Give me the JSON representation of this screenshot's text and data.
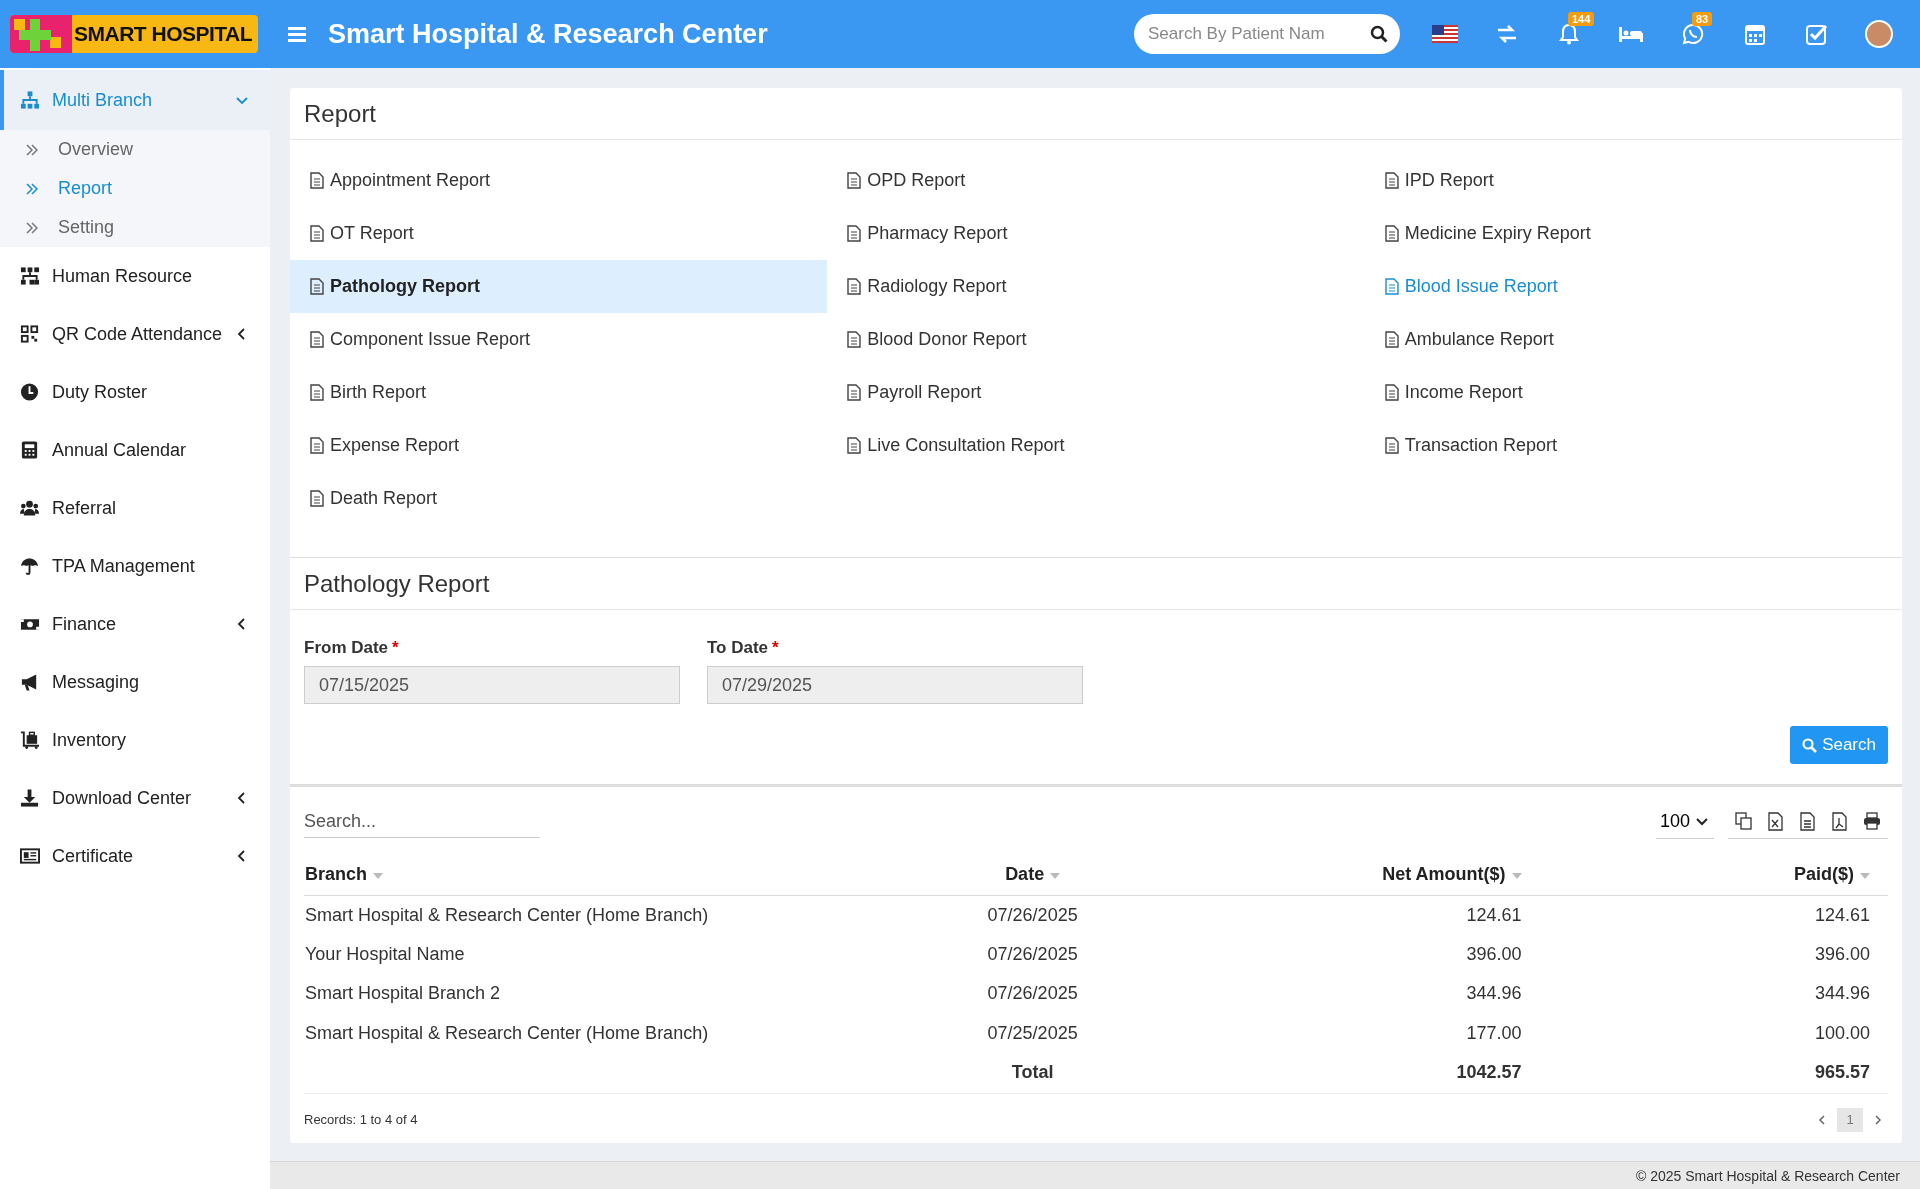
{
  "header": {
    "logo": "SMART HOSPITAL",
    "title": "Smart Hospital & Research Center",
    "search": {
      "placeholder": "Search By Patient Nam"
    },
    "notifications_count": "144",
    "chat_count": "83"
  },
  "sidebar": {
    "items": [
      {
        "label": "Multi Branch",
        "expanded": true,
        "has_submenu": true,
        "children": [
          {
            "label": "Overview",
            "selected": false
          },
          {
            "label": "Report",
            "selected": true
          },
          {
            "label": "Setting",
            "selected": false
          }
        ]
      },
      {
        "label": "Human Resource",
        "expanded": false,
        "has_submenu": false
      },
      {
        "label": "QR Code Attendance",
        "expanded": false,
        "has_submenu": true
      },
      {
        "label": "Duty Roster",
        "expanded": false,
        "has_submenu": false
      },
      {
        "label": "Annual Calendar",
        "expanded": false,
        "has_submenu": false
      },
      {
        "label": "Referral",
        "expanded": false,
        "has_submenu": false
      },
      {
        "label": "TPA Management",
        "expanded": false,
        "has_submenu": false
      },
      {
        "label": "Finance",
        "expanded": false,
        "has_submenu": true
      },
      {
        "label": "Messaging",
        "expanded": false,
        "has_submenu": false
      },
      {
        "label": "Inventory",
        "expanded": false,
        "has_submenu": false
      },
      {
        "label": "Download Center",
        "expanded": false,
        "has_submenu": true
      },
      {
        "label": "Certificate",
        "expanded": false,
        "has_submenu": true
      }
    ]
  },
  "report_panel": {
    "title": "Report",
    "links": [
      {
        "label": "Appointment Report",
        "selected": false,
        "hovered": false
      },
      {
        "label": "OPD Report",
        "selected": false,
        "hovered": false
      },
      {
        "label": "IPD Report",
        "selected": false,
        "hovered": false
      },
      {
        "label": "OT Report",
        "selected": false,
        "hovered": false
      },
      {
        "label": "Pharmacy Report",
        "selected": false,
        "hovered": false
      },
      {
        "label": "Medicine Expiry Report",
        "selected": false,
        "hovered": false
      },
      {
        "label": "Pathology Report",
        "selected": true,
        "hovered": false
      },
      {
        "label": "Radiology Report",
        "selected": false,
        "hovered": false
      },
      {
        "label": "Blood Issue Report",
        "selected": false,
        "hovered": true
      },
      {
        "label": "Component Issue Report",
        "selected": false,
        "hovered": false
      },
      {
        "label": "Blood Donor Report",
        "selected": false,
        "hovered": false
      },
      {
        "label": "Ambulance Report",
        "selected": false,
        "hovered": false
      },
      {
        "label": "Birth Report",
        "selected": false,
        "hovered": false
      },
      {
        "label": "Payroll Report",
        "selected": false,
        "hovered": false
      },
      {
        "label": "Income Report",
        "selected": false,
        "hovered": false
      },
      {
        "label": "Expense Report",
        "selected": false,
        "hovered": false
      },
      {
        "label": "Live Consultation Report",
        "selected": false,
        "hovered": false
      },
      {
        "label": "Transaction Report",
        "selected": false,
        "hovered": false
      },
      {
        "label": "Death Report",
        "selected": false,
        "hovered": false
      }
    ]
  },
  "filter_panel": {
    "title": "Pathology Report",
    "fields": [
      {
        "label": "From Date",
        "required_mark": "*",
        "value": "07/15/2025"
      },
      {
        "label": "To Date",
        "required_mark": "*",
        "value": "07/29/2025"
      }
    ],
    "search_button": "Search"
  },
  "table": {
    "search": {
      "placeholder": "Search..."
    },
    "page_size": "100",
    "columns": [
      {
        "label": "Branch"
      },
      {
        "label": "Date"
      },
      {
        "label": "Net Amount($)"
      },
      {
        "label": "Paid($)"
      }
    ],
    "rows": [
      [
        "Smart Hospital & Research Center (Home Branch)",
        "07/26/2025",
        "124.61",
        "124.61"
      ],
      [
        "Your Hospital Name",
        "07/26/2025",
        "396.00",
        "396.00"
      ],
      [
        "Smart Hospital Branch 2",
        "07/26/2025",
        "344.96",
        "344.96"
      ],
      [
        "Smart Hospital & Research Center (Home Branch)",
        "07/25/2025",
        "177.00",
        "100.00"
      ]
    ],
    "total": {
      "label": "Total",
      "net_amount": "1042.57",
      "paid": "965.57"
    },
    "records": "Records: 1 to 4 of 4",
    "pages": [
      {
        "label": "1",
        "selected": true
      }
    ]
  },
  "footer": "© 2025 Smart Hospital & Research Center"
}
